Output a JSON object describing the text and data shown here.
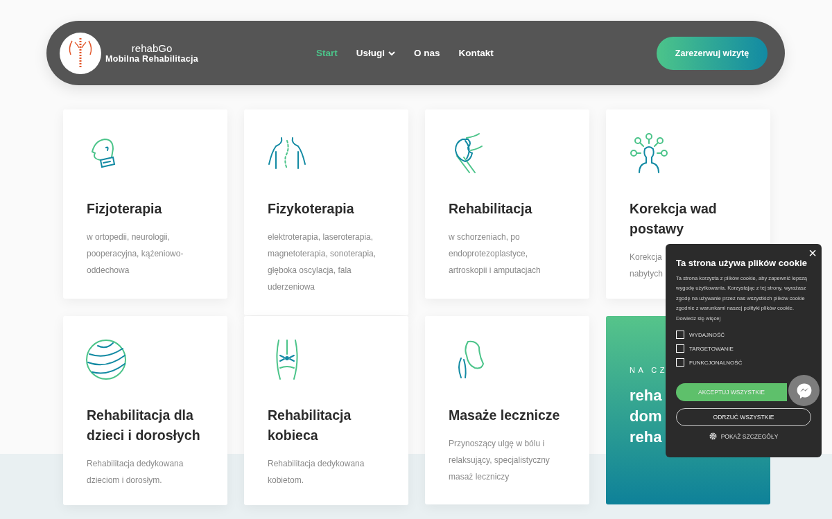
{
  "header": {
    "logo": {
      "brand": "rehabGo",
      "tagline": "Mobilna Rehabilitacja"
    },
    "nav": [
      {
        "label": "Start",
        "selected": true,
        "dropdown": false
      },
      {
        "label": "Usługi",
        "selected": false,
        "dropdown": true
      },
      {
        "label": "O nas",
        "selected": false,
        "dropdown": false
      },
      {
        "label": "Kontakt",
        "selected": false,
        "dropdown": false
      }
    ],
    "cta": "Zarezerwuj wizytę"
  },
  "cards": [
    {
      "kind": "neck",
      "title": [
        "Fizjoterapia"
      ],
      "desc": [
        "w ortopedii, neurologii,",
        "pooperacyjna, kążeniowo-",
        "oddechowa"
      ]
    },
    {
      "kind": "back",
      "title": [
        "Fizykoterapia"
      ],
      "desc": [
        "elektroterapia, laseroterapia,",
        "magnetoterapia, sonoterapia,",
        "głęboka oscylacja, fala",
        "uderzeniowa"
      ]
    },
    {
      "kind": "knee",
      "title": [
        "Rehabilitacja"
      ],
      "desc": [
        "w schorzeniach, po",
        "endoprotezoplastyce,",
        "artroskopii i amputacjach"
      ]
    },
    {
      "kind": "posture",
      "title": [
        "Korekcja wad",
        "postawy"
      ],
      "desc": [
        "Korekcja",
        "nabytych"
      ]
    },
    {
      "kind": "ball",
      "title": [
        "Rehabilitacja dla",
        "dzieci i dorosłych"
      ],
      "desc": [
        "Rehabilitacja dedykowana",
        "dzieciom i dorosłym."
      ]
    },
    {
      "kind": "hips",
      "title": [
        "Rehabilitacja",
        "kobieca"
      ],
      "desc": [
        "Rehabilitacja dedykowana",
        "kobietom."
      ]
    },
    {
      "kind": "foot",
      "title": [
        "Masaże lecznicze"
      ],
      "desc": [
        "Przynoszący ulgę w bólu i",
        "relaksujący, specjalistyczny",
        "masaż leczniczy"
      ]
    }
  ],
  "promo": {
    "eyebrow": "NA CZ",
    "lines": [
      "reha",
      "dom",
      "reha"
    ]
  },
  "cookie_popup": {
    "close": "×",
    "title": "Ta strona używa plików cookie",
    "text": "Ta strona korzysta z plików cookie, aby zapewnić lepszą wygodę użytkowania. Korzystając z tej strony, wyrażasz zgodę na używanie przez nas wszystkich plików cookie zgodnie z warunkami naszej polityki plików cookie. Dowiedz się więcej",
    "options": [
      {
        "label": "WYDAJNOŚĆ",
        "checked": false
      },
      {
        "label": "TARGETOWANIE",
        "checked": false
      },
      {
        "label": "FUNKCJONALNOŚĆ",
        "checked": false
      }
    ],
    "accept": "AKCEPTUJ WSZYSTKIE",
    "reject": "ODRZUĆ WSZYSTKIE",
    "details": "POKAŻ SZCZEGÓŁY"
  }
}
